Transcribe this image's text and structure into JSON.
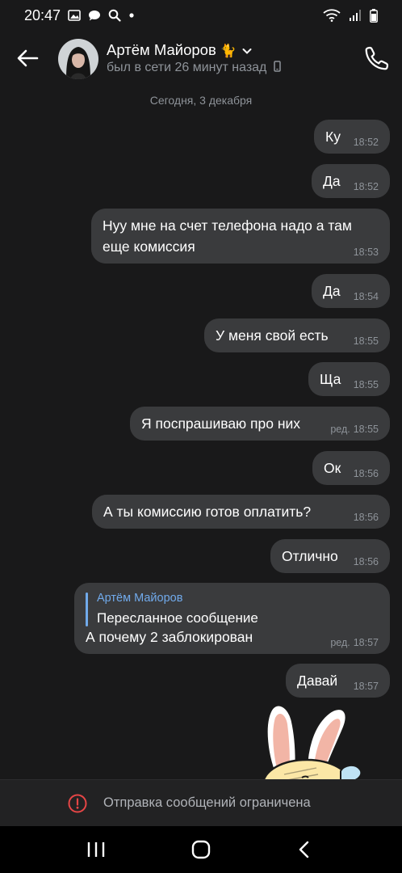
{
  "status_bar": {
    "time": "20:47",
    "left_icons": [
      "image-icon",
      "chat-icon",
      "search-icon",
      "dot-icon"
    ],
    "right_icons": [
      "wifi-icon",
      "signal-icon",
      "battery-icon"
    ]
  },
  "header": {
    "contact_name": "Артём Майоров",
    "name_emoji": "🐈",
    "status": "был в сети 26 минут назад",
    "status_device_icon": "mobile-icon"
  },
  "chat": {
    "date_separator": "Сегодня, 3 декабря",
    "messages": [
      {
        "text": "Ку",
        "time": "18:52"
      },
      {
        "text": "Да",
        "time": "18:52"
      },
      {
        "text_line1": "Нуу мне на счет телефона надо а там",
        "text_line2": "еще комиссия",
        "time": "18:53"
      },
      {
        "text": "Да",
        "time": "18:54"
      },
      {
        "text": "У меня свой есть",
        "time": "18:55"
      },
      {
        "text": "Ща",
        "time": "18:55"
      },
      {
        "text": "Я поспрашиваю про них",
        "edited": "ред.",
        "time": "18:55"
      },
      {
        "text": "Ок",
        "time": "18:56"
      },
      {
        "text": "А ты комиссию готов оплатить?",
        "time": "18:56"
      },
      {
        "text": "Отлично",
        "time": "18:56"
      },
      {
        "forward_author": "Артём Майоров",
        "forward_text": "Пересланное сообщение",
        "text": "А почему 2 заблокирован",
        "edited": "ред.",
        "time": "18:57"
      },
      {
        "text": "Давай",
        "time": "18:57"
      }
    ]
  },
  "bottom_panel": {
    "icon": "alert-circle-icon",
    "text": "Отправка сообщений ограничена"
  },
  "navigation_bar": {
    "icons": [
      "recents-icon",
      "home-icon",
      "back-icon"
    ]
  },
  "colors": {
    "background": "#19191a",
    "bubble": "#3a3b3d",
    "accent": "#71aaeb",
    "alert": "#e64646"
  }
}
